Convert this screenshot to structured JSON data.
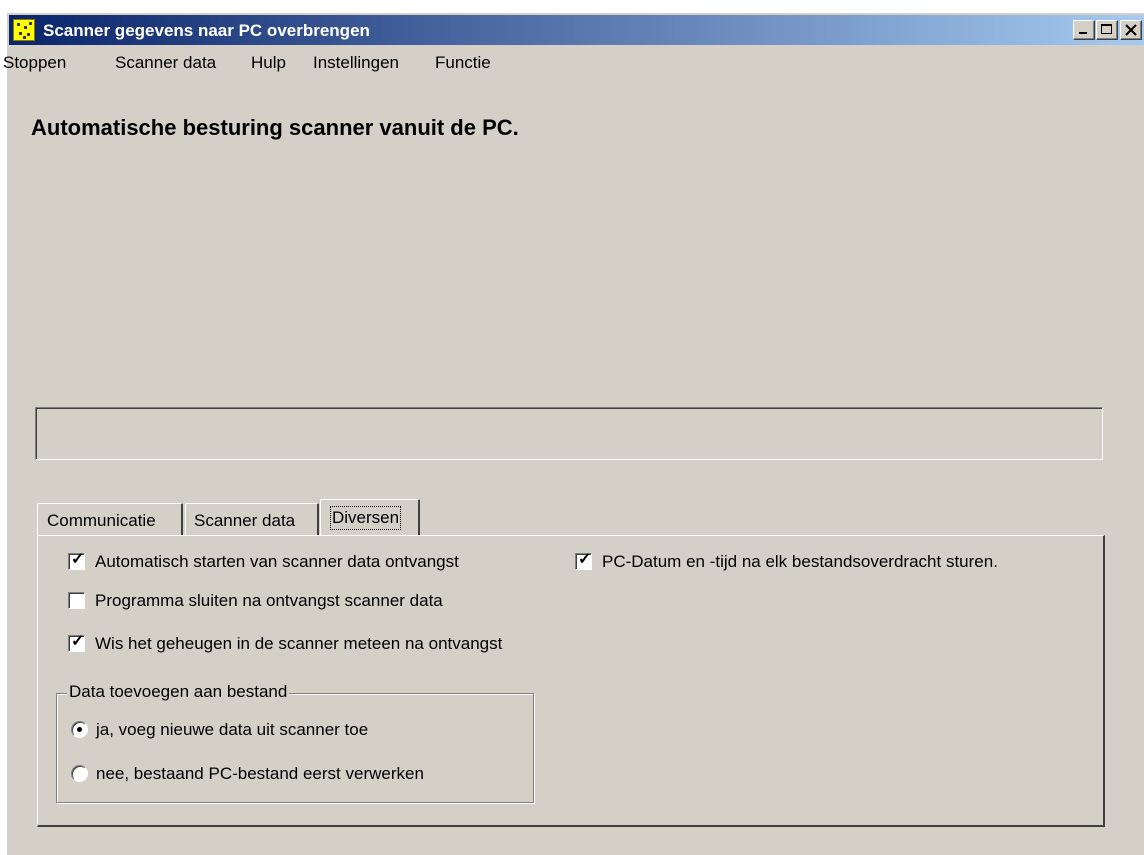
{
  "window": {
    "title": "Scanner gegevens naar PC overbrengen",
    "app_icon": "scanner-app-icon",
    "caption_buttons": [
      "minimize-icon",
      "maximize-icon",
      "close-icon"
    ]
  },
  "menubar": {
    "items": [
      {
        "label": "Stoppen"
      },
      {
        "label": "Scanner data"
      },
      {
        "label": "Hulp"
      },
      {
        "label": "Instellingen"
      },
      {
        "label": "Functie"
      }
    ]
  },
  "heading": "Automatische besturing scanner vanuit de PC.",
  "status": {
    "text": ""
  },
  "tabs": [
    {
      "label": "Communicatie",
      "active": false
    },
    {
      "label": "Scanner data",
      "active": false
    },
    {
      "label": "Diversen",
      "active": true
    }
  ],
  "diversen": {
    "auto_start": {
      "label": "Automatisch starten van scanner data ontvangst",
      "checked": true
    },
    "close_after": {
      "label": "Programma sluiten na ontvangst scanner data",
      "checked": false
    },
    "clear_memory": {
      "label": "Wis het geheugen in de scanner meteen na ontvangst",
      "checked": true
    },
    "send_datetime": {
      "label": "PC-Datum en -tijd na elk bestandsoverdracht sturen.",
      "checked": true
    },
    "append_group": {
      "label": "Data toevoegen aan bestand",
      "options": [
        {
          "label": "ja, voeg nieuwe data uit scanner toe",
          "selected": true
        },
        {
          "label": "nee, bestaand PC-bestand eerst verwerken",
          "selected": false
        }
      ]
    }
  },
  "colors": {
    "titlebar_start": "#0a246a",
    "titlebar_end": "#a6caf0",
    "face": "#d4d0c8"
  }
}
